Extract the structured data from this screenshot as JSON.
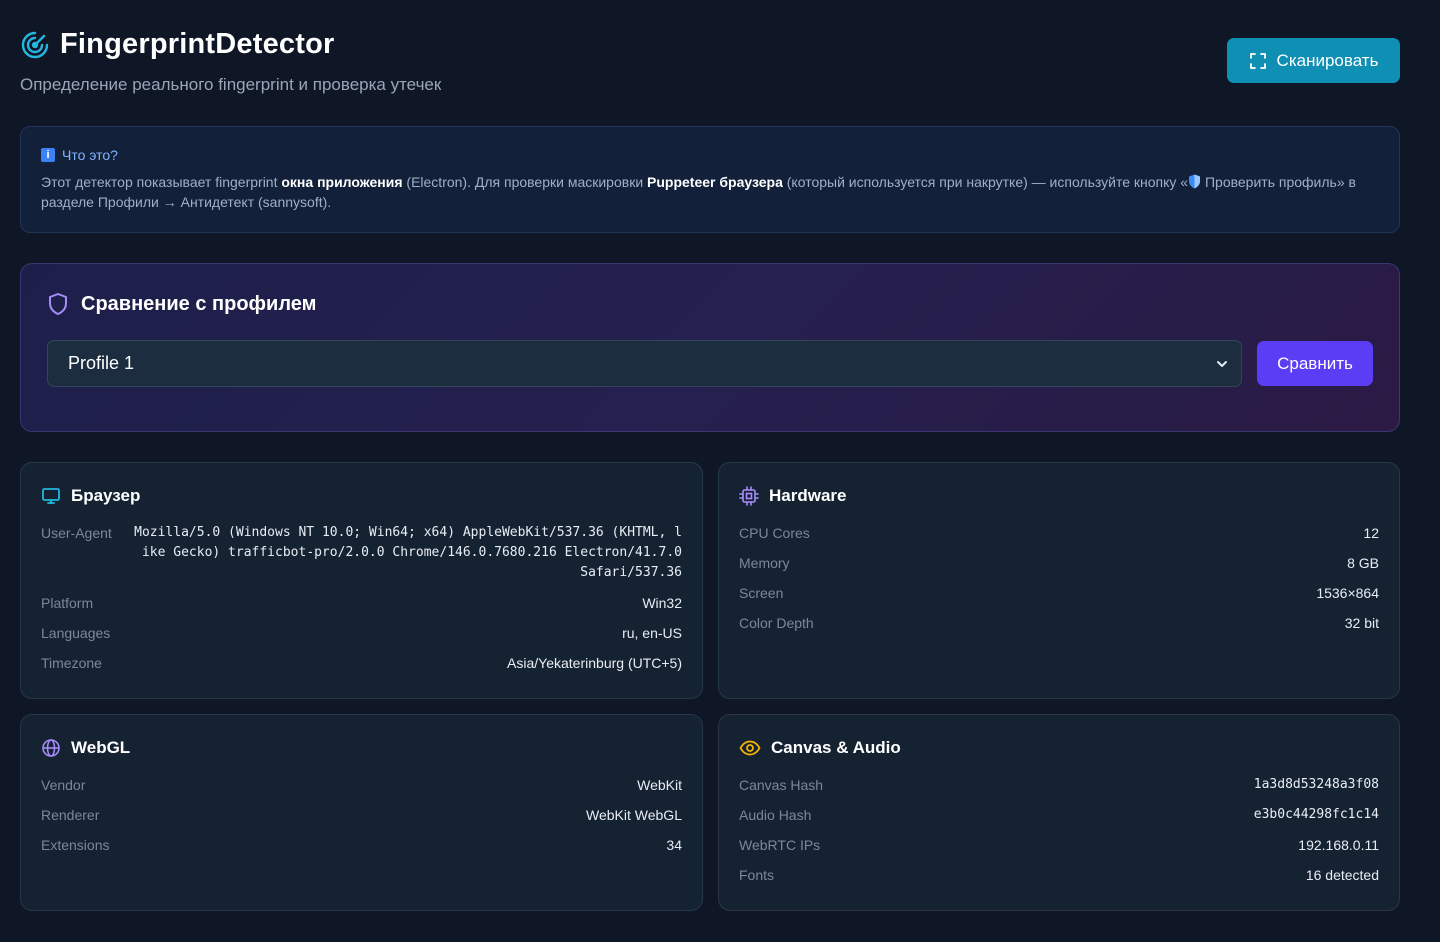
{
  "header": {
    "title": "FingerprintDetector",
    "subtitle": "Определение реального fingerprint и проверка утечек",
    "scan_label": "Сканировать"
  },
  "info": {
    "heading": "Что это?",
    "text_1": "Этот детектор показывает fingerprint ",
    "bold_1": "окна приложения",
    "text_2": " (Electron). Для проверки маскировки ",
    "bold_2": "Puppeteer браузера",
    "text_3": " (который используется при накрутке) — используйте кнопку «",
    "text_4": " Проверить профиль» в разделе Профили → Антидетект (sannysoft)."
  },
  "compare": {
    "heading": "Сравнение с профилем",
    "selected_profile": "Profile 1",
    "compare_label": "Сравнить"
  },
  "browser": {
    "heading": "Браузер",
    "rows": [
      {
        "key": "User-Agent",
        "value": "Mozilla/5.0 (Windows NT 10.0; Win64; x64) AppleWebKit/537.36 (KHTML, like Gecko) trafficbot-pro/2.0.0 Chrome/146.0.7680.216 Electron/41.7.0 Safari/537.36"
      },
      {
        "key": "Platform",
        "value": "Win32"
      },
      {
        "key": "Languages",
        "value": "ru, en-US"
      },
      {
        "key": "Timezone",
        "value": "Asia/Yekaterinburg (UTC+5)"
      }
    ]
  },
  "hardware": {
    "heading": "Hardware",
    "rows": [
      {
        "key": "CPU Cores",
        "value": "12"
      },
      {
        "key": "Memory",
        "value": "8 GB"
      },
      {
        "key": "Screen",
        "value": "1536×864"
      },
      {
        "key": "Color Depth",
        "value": "32 bit"
      }
    ]
  },
  "webgl": {
    "heading": "WebGL",
    "rows": [
      {
        "key": "Vendor",
        "value": "WebKit"
      },
      {
        "key": "Renderer",
        "value": "WebKit WebGL"
      },
      {
        "key": "Extensions",
        "value": "34"
      }
    ]
  },
  "canvas": {
    "heading": "Canvas & Audio",
    "rows": [
      {
        "key": "Canvas Hash",
        "value": "1a3d8d53248a3f08"
      },
      {
        "key": "Audio Hash",
        "value": "e3b0c44298fc1c14"
      },
      {
        "key": "WebRTC IPs",
        "value": "192.168.0.11"
      },
      {
        "key": "Fonts",
        "value": "16 detected"
      }
    ]
  },
  "colors": {
    "background": "#0f1626",
    "scan_button": "#0e8fb3",
    "compare_button": "#5b3df5",
    "accent_cyan": "#22b8e0",
    "accent_purple": "#a78bfa",
    "accent_yellow": "#f5b301"
  },
  "icons": {
    "logo": "radar-icon",
    "scan": "scan-frame-icon",
    "info": "info-icon",
    "compare": "shield-icon",
    "browser": "monitor-icon",
    "hardware": "cpu-icon",
    "webgl": "globe-icon",
    "canvas": "eye-icon"
  }
}
